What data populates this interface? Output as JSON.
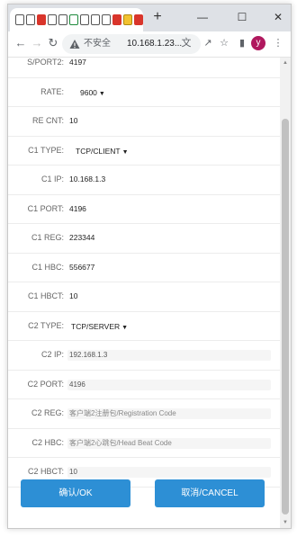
{
  "window": {
    "controls": {
      "minimize": "—",
      "maximize": "☐",
      "close": "✕"
    },
    "new_tab": "+"
  },
  "toolbar": {
    "security_label": "不安全",
    "url": "10.168.1.23...",
    "avatar_letter": "y"
  },
  "form": {
    "sport2": {
      "label": "S/PORT2:",
      "value": "4197"
    },
    "rate": {
      "label": "RATE:",
      "value": "9600"
    },
    "re_cnt": {
      "label": "RE CNT:",
      "value": "10"
    },
    "c1_type": {
      "label": "C1 TYPE:",
      "value": "TCP/CLIENT"
    },
    "c1_ip": {
      "label": "C1 IP:",
      "value": "10.168.1.3"
    },
    "c1_port": {
      "label": "C1 PORT:",
      "value": "4196"
    },
    "c1_reg": {
      "label": "C1 REG:",
      "value": "223344"
    },
    "c1_hbc": {
      "label": "C1 HBC:",
      "value": "556677"
    },
    "c1_hbct": {
      "label": "C1 HBCT:",
      "value": "10"
    },
    "c2_type": {
      "label": "C2 TYPE:",
      "value": "TCP/SERVER"
    },
    "c2_ip": {
      "label": "C2 IP:",
      "value": "192.168.1.3"
    },
    "c2_port": {
      "label": "C2 PORT:",
      "value": "4196"
    },
    "c2_reg": {
      "label": "C2 REG:",
      "placeholder": "客户端2注册包/Registration Code"
    },
    "c2_hbc": {
      "label": "C2 HBC:",
      "placeholder": "客户端2心跳包/Head Beat Code"
    },
    "c2_hbct": {
      "label": "C2 HBCT:",
      "value": "10"
    }
  },
  "actions": {
    "ok": "确认/OK",
    "cancel": "取消/CANCEL"
  },
  "colors": {
    "primary_button": "#2d8fd5",
    "avatar": "#b0185e"
  }
}
